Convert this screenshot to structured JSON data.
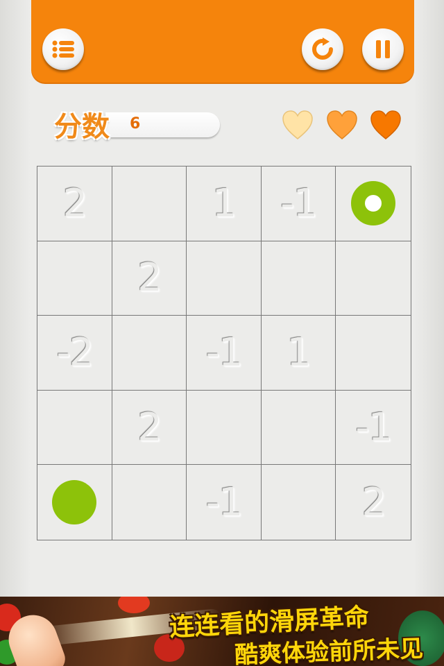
{
  "header": {
    "menu_icon": "list-icon",
    "restart_icon": "restart-icon",
    "pause_icon": "pause-icon",
    "color": "#f5840c"
  },
  "score": {
    "label": "分数",
    "value": "6"
  },
  "lives": [
    {
      "icon": "heart-icon",
      "color": "#ffe3a6"
    },
    {
      "icon": "heart-icon",
      "color": "#ffa13a"
    },
    {
      "icon": "heart-icon",
      "color": "#f77800"
    }
  ],
  "board": {
    "rows": [
      [
        "2",
        "",
        "1",
        "-1",
        "ring"
      ],
      [
        "",
        "2",
        "",
        "",
        ""
      ],
      [
        "-2",
        "",
        "-1",
        "1",
        ""
      ],
      [
        "",
        "2",
        "",
        "",
        "-1"
      ],
      [
        "dot",
        "",
        "-1",
        "",
        "2"
      ]
    ],
    "piece_color": "#8dc20a"
  },
  "banner": {
    "line1": "连连看的滑屏革命",
    "line2": "酷爽体验前所未见"
  }
}
